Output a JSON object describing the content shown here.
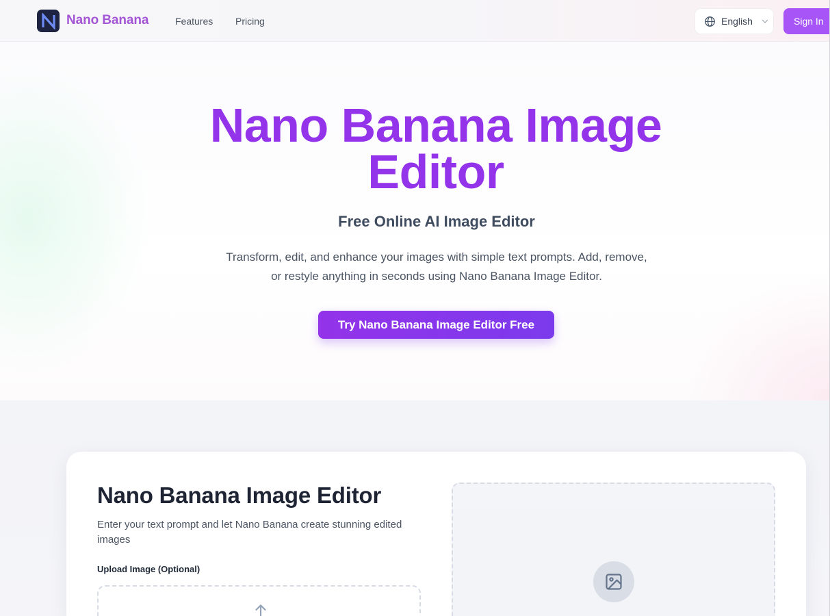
{
  "nav": {
    "brand": "Nano Banana",
    "logo_letter": "N",
    "links": [
      "Features",
      "Pricing"
    ],
    "language": "English",
    "sign_in": "Sign In"
  },
  "hero": {
    "title": "Nano Banana Image Editor",
    "subtitle": "Free Online AI Image Editor",
    "description": "Transform, edit, and enhance your images with simple text prompts. Add, remove, or restyle anything in seconds using Nano Banana Image Editor.",
    "cta": "Try Nano Banana Image Editor Free"
  },
  "editor": {
    "title": "Nano Banana Image Editor",
    "description": "Enter your text prompt and let Nano Banana create stunning edited images",
    "upload_label": "Upload Image (Optional)"
  },
  "icons": {
    "logo": "n-logo-icon",
    "language": "globe-icon",
    "language_caret": "chevron-down-icon",
    "upload": "upload-arrow-icon",
    "preview": "image-icon"
  },
  "colors": {
    "brand_purple": "#9333ea",
    "brand_text": "#a455d6",
    "cta_gradient_end": "#7c3aed",
    "sign_in_bg": "#a855f7",
    "logo_bg": "#1d2340"
  }
}
